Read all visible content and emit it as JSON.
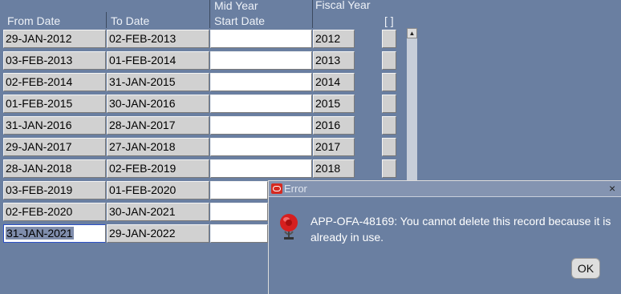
{
  "columns": {
    "from_date": "From Date",
    "to_date": "To Date",
    "mid_year_line1": "Mid Year",
    "mid_year_line2": "Start Date",
    "fiscal_year": "Fiscal Year",
    "flag": "[ ]"
  },
  "rows": [
    {
      "from": "29-JAN-2012",
      "to": "02-FEB-2013",
      "mid": "",
      "year": "2012"
    },
    {
      "from": "03-FEB-2013",
      "to": "01-FEB-2014",
      "mid": "",
      "year": "2013"
    },
    {
      "from": "02-FEB-2014",
      "to": "31-JAN-2015",
      "mid": "",
      "year": "2014"
    },
    {
      "from": "01-FEB-2015",
      "to": "30-JAN-2016",
      "mid": "",
      "year": "2015"
    },
    {
      "from": "31-JAN-2016",
      "to": "28-JAN-2017",
      "mid": "",
      "year": "2016"
    },
    {
      "from": "29-JAN-2017",
      "to": "27-JAN-2018",
      "mid": "",
      "year": "2017"
    },
    {
      "from": "28-JAN-2018",
      "to": "02-FEB-2019",
      "mid": "",
      "year": "2018"
    },
    {
      "from": "03-FEB-2019",
      "to": "01-FEB-2020",
      "mid": "",
      "year": ""
    },
    {
      "from": "02-FEB-2020",
      "to": "30-JAN-2021",
      "mid": "",
      "year": ""
    },
    {
      "from": "31-JAN-2021",
      "to": "29-JAN-2022",
      "mid": "",
      "year": ""
    }
  ],
  "scrollbar": {
    "up_arrow": "▲"
  },
  "error_dialog": {
    "title": "Error",
    "close": "×",
    "message": "APP-OFA-48169: You cannot delete this record because it is already in use.",
    "ok_label": "OK"
  },
  "colors": {
    "background": "#6a7fa1",
    "field": "#d1d1d1",
    "selection": "#7f8dac",
    "icon_red": "#d62a20"
  },
  "icons": [
    "oracle-logo-icon",
    "alarm-bell-icon",
    "close-icon",
    "scroll-up-arrow-icon"
  ]
}
